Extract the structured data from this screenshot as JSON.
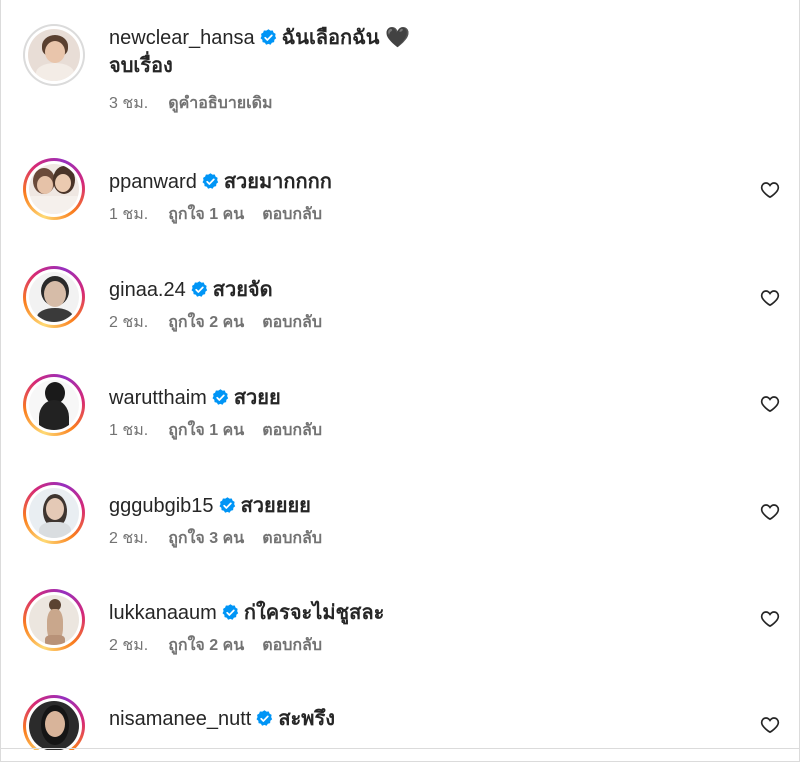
{
  "post_caption": {
    "username": "newclear_hansa",
    "text_line1": "ฉันเลือกฉัน 🖤",
    "text_line2": "จบเรื่อง",
    "time": "3 ชม.",
    "see_translation": "ดูคำอธิบายเดิม"
  },
  "comments": [
    {
      "username": "ppanward",
      "text": "สวยมากกกก",
      "time": "1 ชม.",
      "likes": "ถูกใจ 1 คน",
      "reply": "ตอบกลับ"
    },
    {
      "username": "ginaa.24",
      "text": "สวยจัด",
      "time": "2 ชม.",
      "likes": "ถูกใจ 2 คน",
      "reply": "ตอบกลับ"
    },
    {
      "username": "warutthaim",
      "text": "สวยย",
      "time": "1 ชม.",
      "likes": "ถูกใจ 1 คน",
      "reply": "ตอบกลับ"
    },
    {
      "username": "gggubgib15",
      "text": "สวยยยย",
      "time": "2 ชม.",
      "likes": "ถูกใจ 3 คน",
      "reply": "ตอบกลับ"
    },
    {
      "username": "lukkanaaum",
      "text": "ก่ใครจะไม่ชูสละ",
      "time": "2 ชม.",
      "likes": "ถูกใจ 2 คน",
      "reply": "ตอบกลับ"
    },
    {
      "username": "nisamanee_nutt",
      "text": "สะพรึง"
    }
  ],
  "colors": {
    "verified": "#0095f6",
    "secondary_text": "#737373",
    "primary_text": "#262626"
  },
  "icons": {
    "verified": "verified-badge-icon",
    "like": "heart-outline-icon"
  }
}
